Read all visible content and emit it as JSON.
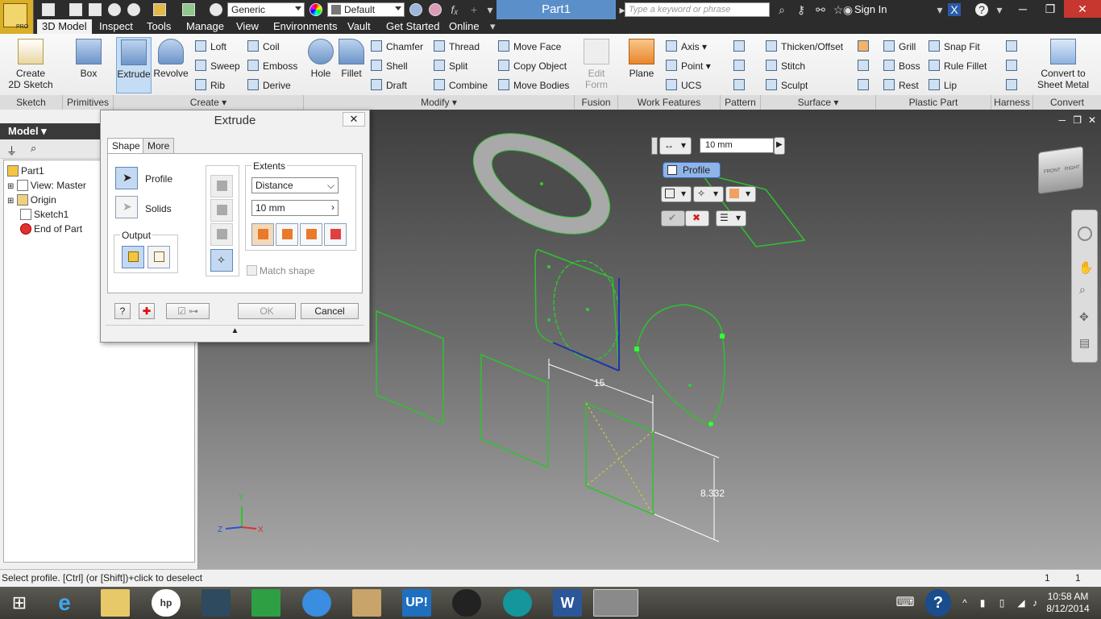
{
  "app": {
    "doc_title": "Part1",
    "search_placeholder": "Type a keyword or phrase",
    "sign_in": "Sign In",
    "pro_badge": "PRO"
  },
  "quick_access": {
    "material": "Generic",
    "appearance": "Default",
    "fx": "fₓ"
  },
  "tabs": [
    "3D Model",
    "Inspect",
    "Tools",
    "Manage",
    "View",
    "Environments",
    "Vault",
    "Get Started",
    "Online"
  ],
  "ribbon": {
    "sketch": {
      "create_2d": "Create",
      "create_2d_line2": "2D Sketch",
      "label": "Sketch"
    },
    "primitives": {
      "box": "Box",
      "label": "Primitives"
    },
    "create": {
      "extrude": "Extrude",
      "revolve": "Revolve",
      "loft": "Loft",
      "sweep": "Sweep",
      "rib": "Rib",
      "coil": "Coil",
      "emboss": "Emboss",
      "derive": "Derive",
      "label": "Create"
    },
    "modify": {
      "hole": "Hole",
      "fillet": "Fillet",
      "chamfer": "Chamfer",
      "shell": "Shell",
      "draft": "Draft",
      "thread": "Thread",
      "split": "Split",
      "combine": "Combine",
      "move_face": "Move Face",
      "copy_object": "Copy Object",
      "move_bodies": "Move Bodies",
      "label": "Modify"
    },
    "fusion": {
      "edit_form": "Edit",
      "edit_form_line2": "Form",
      "label": "Fusion"
    },
    "work_features": {
      "plane": "Plane",
      "axis": "Axis",
      "point": "Point",
      "ucs": "UCS",
      "label": "Work Features"
    },
    "pattern": {
      "label": "Pattern"
    },
    "surface": {
      "thicken": "Thicken/Offset",
      "stitch": "Stitch",
      "sculpt": "Sculpt",
      "label": "Surface"
    },
    "plastic": {
      "grill": "Grill",
      "boss": "Boss",
      "rest": "Rest",
      "snap_fit": "Snap Fit",
      "rule_fillet": "Rule Fillet",
      "lip": "Lip",
      "label": "Plastic Part"
    },
    "harness": {
      "label": "Harness"
    },
    "convert": {
      "to_sheet_metal": "Convert to",
      "to_sheet_metal_line2": "Sheet Metal",
      "label": "Convert"
    }
  },
  "browser": {
    "title": "Model",
    "items": [
      "Part1",
      "View: Master",
      "Origin",
      "Sketch1",
      "End of Part"
    ]
  },
  "dialog": {
    "title": "Extrude",
    "tabs": [
      "Shape",
      "More"
    ],
    "profile": "Profile",
    "solids": "Solids",
    "output": "Output",
    "extents": "Extents",
    "extent_type": "Distance",
    "distance": "10 mm",
    "match_shape": "Match shape",
    "ok": "OK",
    "cancel": "Cancel"
  },
  "minitoolbar": {
    "distance": "10 mm",
    "profile": "Profile"
  },
  "dimensions": {
    "horizontal": "15",
    "vertical": "8.332"
  },
  "triad": {
    "x": "X",
    "y": "Y",
    "z": "Z"
  },
  "viewcube": {
    "front": "FRONT",
    "right": "RIGHT"
  },
  "status": {
    "message": "Select profile. [Ctrl] (or [Shift])+click to deselect",
    "count1": "1",
    "count2": "1"
  },
  "clock": {
    "time": "10:58 AM",
    "date": "8/12/2014"
  },
  "taskbar": {
    "up_label": "UP!"
  },
  "colors": {
    "accent": "#5b8fc9",
    "sketch": "#2ec32e",
    "titlebar": "#2c2c2c",
    "close": "#c7372f"
  }
}
